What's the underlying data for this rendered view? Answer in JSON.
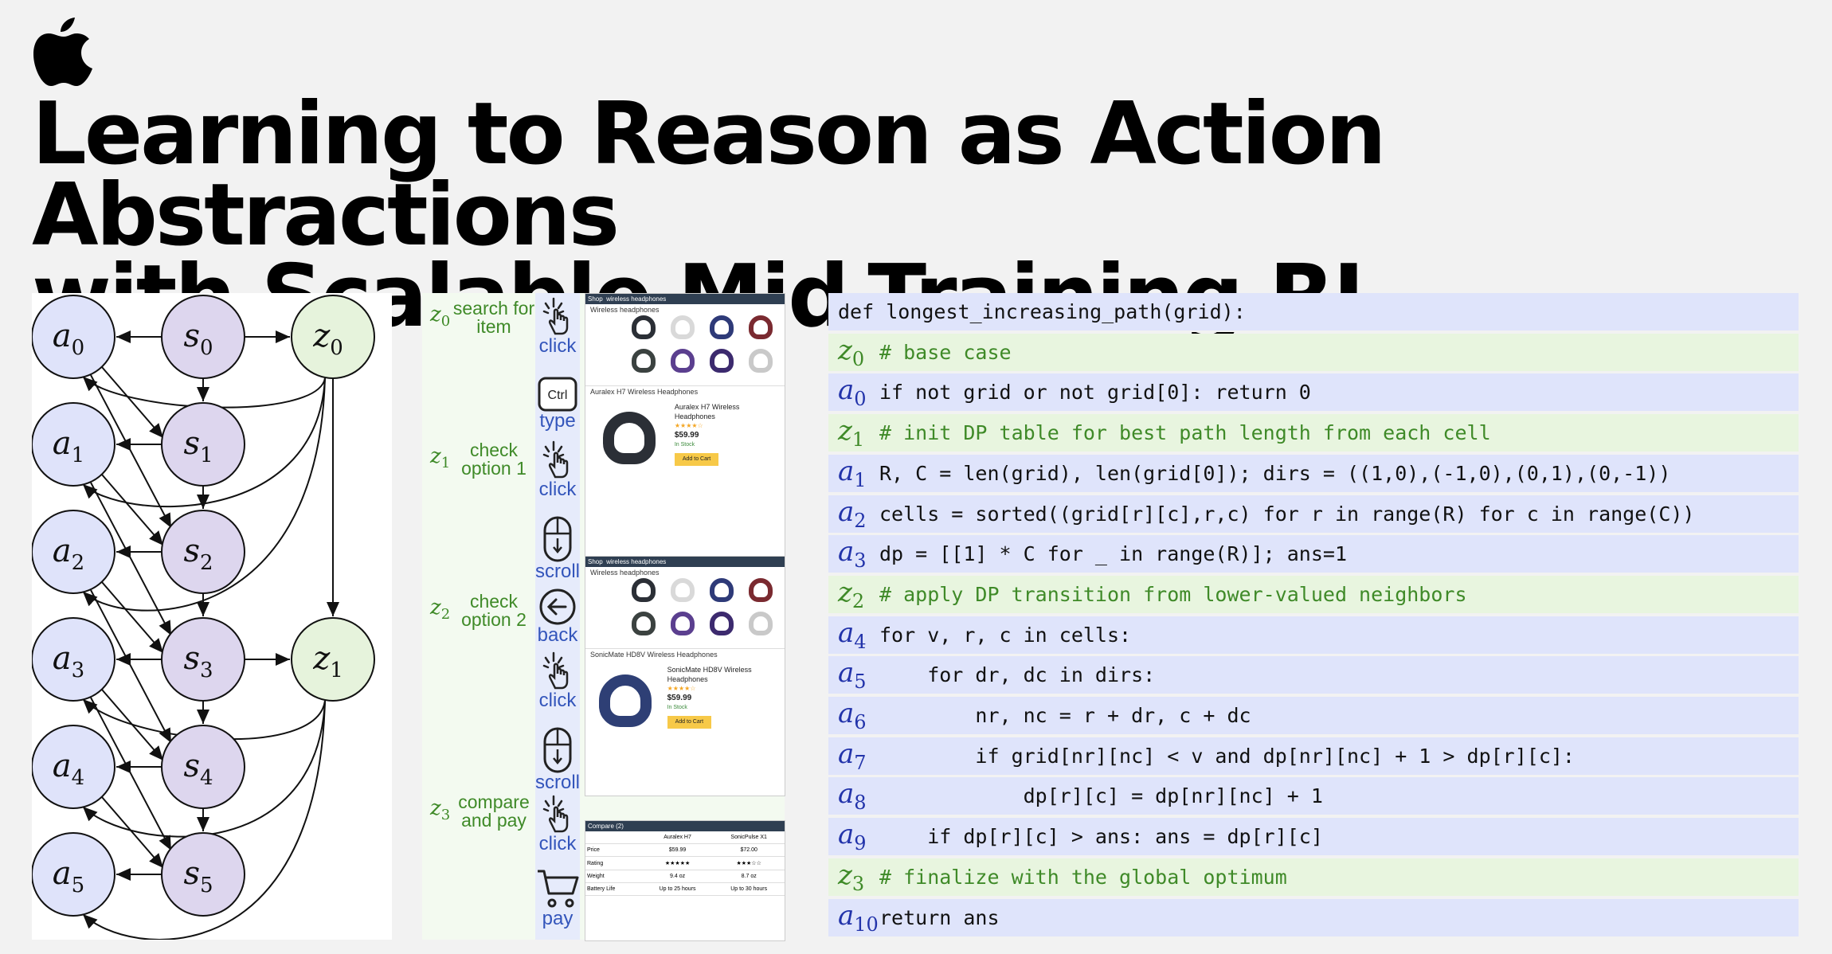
{
  "title": {
    "line1": "Learning to Reason as Action Abstractions",
    "line2": "with Scalable Mid-Training RL"
  },
  "graph": {
    "a_nodes": [
      {
        "sym": "a",
        "sub": "0"
      },
      {
        "sym": "a",
        "sub": "1"
      },
      {
        "sym": "a",
        "sub": "2"
      },
      {
        "sym": "a",
        "sub": "3"
      },
      {
        "sym": "a",
        "sub": "4"
      },
      {
        "sym": "a",
        "sub": "5"
      }
    ],
    "s_nodes": [
      {
        "sym": "s",
        "sub": "0"
      },
      {
        "sym": "s",
        "sub": "1"
      },
      {
        "sym": "s",
        "sub": "2"
      },
      {
        "sym": "s",
        "sub": "3"
      },
      {
        "sym": "s",
        "sub": "4"
      },
      {
        "sym": "s",
        "sub": "5"
      }
    ],
    "z_nodes": [
      {
        "sym": "z",
        "sub": "0"
      },
      {
        "sym": "z",
        "sub": "1"
      }
    ],
    "colors": {
      "a_fill": "#dfe3fa",
      "s_fill": "#ddd6ee",
      "z_fill": "#e6f3dc",
      "stroke": "#111111"
    }
  },
  "web": {
    "z_labels": [
      {
        "sym": "z",
        "sub": "0",
        "text": "search for item"
      },
      {
        "sym": "z",
        "sub": "1",
        "text": "check option 1"
      },
      {
        "sym": "z",
        "sub": "2",
        "text": "check option 2"
      },
      {
        "sym": "z",
        "sub": "3",
        "text": "compare and pay"
      }
    ],
    "actions": [
      {
        "icon": "click-hand-icon",
        "label": "click"
      },
      {
        "icon": "ctrl-key-icon",
        "label": "type",
        "key": "Ctrl"
      },
      {
        "icon": "click-hand-icon",
        "label": "click"
      },
      {
        "icon": "mouse-scroll-icon",
        "label": "scroll"
      },
      {
        "icon": "back-arrow-icon",
        "label": "back"
      },
      {
        "icon": "click-hand-icon",
        "label": "click"
      },
      {
        "icon": "mouse-scroll-icon",
        "label": "scroll"
      },
      {
        "icon": "click-hand-icon",
        "label": "click"
      },
      {
        "icon": "shopping-cart-icon",
        "label": "pay"
      }
    ],
    "screens": {
      "search_results": {
        "heading": "Wireless headphones",
        "colors": [
          "#2b2f36",
          "#d9d9d9",
          "#2e3a78",
          "#7a2a30",
          "#3b4240",
          "#5b3f8f",
          "#3c2a6e",
          "#c9c9c9"
        ]
      },
      "product1": {
        "name": "Auralex H7 Wireless Headphones",
        "price": "$59.99",
        "stock": "In Stock",
        "cart": "Add to Cart",
        "color": "#2b2f36"
      },
      "product2": {
        "name": "SonicMate HD8V Wireless Headphones",
        "price": "$59.99",
        "stock": "In Stock",
        "cart": "Add to Cart",
        "color": "#2e3f75"
      },
      "compare": {
        "header": "Compare (2)",
        "cols": [
          "Auralex H7",
          "SonicPulse X1"
        ],
        "rows": [
          [
            "Price",
            "$59.99",
            "$72.00"
          ],
          [
            "Rating",
            "★★★★★",
            "★★★☆☆"
          ],
          [
            "Weight",
            "9.4 oz",
            "8.7 oz"
          ],
          [
            "Battery Life",
            "Up to 25 hours",
            "Up to 30 hours"
          ]
        ]
      }
    }
  },
  "code": {
    "header": "def longest_increasing_path(grid):",
    "lines": [
      {
        "kind": "z",
        "sym": "z",
        "sub": "0",
        "text": "# base case"
      },
      {
        "kind": "a",
        "sym": "a",
        "sub": "0",
        "text": "if not grid or not grid[0]: return 0"
      },
      {
        "kind": "z",
        "sym": "z",
        "sub": "1",
        "text": "# init DP table for best path length from each cell"
      },
      {
        "kind": "a",
        "sym": "a",
        "sub": "1",
        "text": "R, C = len(grid), len(grid[0]); dirs = ((1,0),(-1,0),(0,1),(0,-1))"
      },
      {
        "kind": "a",
        "sym": "a",
        "sub": "2",
        "text": "cells = sorted((grid[r][c],r,c) for r in range(R) for c in range(C))"
      },
      {
        "kind": "a",
        "sym": "a",
        "sub": "3",
        "text": "dp = [[1] * C for _ in range(R)]; ans=1"
      },
      {
        "kind": "z",
        "sym": "z",
        "sub": "2",
        "text": "# apply DP transition from lower-valued neighbors"
      },
      {
        "kind": "a",
        "sym": "a",
        "sub": "4",
        "text": "for v, r, c in cells:"
      },
      {
        "kind": "a",
        "sym": "a",
        "sub": "5",
        "text": "    for dr, dc in dirs:"
      },
      {
        "kind": "a",
        "sym": "a",
        "sub": "6",
        "text": "        nr, nc = r + dr, c + dc"
      },
      {
        "kind": "a",
        "sym": "a",
        "sub": "7",
        "text": "        if grid[nr][nc] < v and dp[nr][nc] + 1 > dp[r][c]:"
      },
      {
        "kind": "a",
        "sym": "a",
        "sub": "8",
        "text": "            dp[r][c] = dp[nr][nc] + 1"
      },
      {
        "kind": "a",
        "sym": "a",
        "sub": "9",
        "text": "    if dp[r][c] > ans: ans = dp[r][c]"
      },
      {
        "kind": "z",
        "sym": "z",
        "sub": "3",
        "text": "# finalize with the global optimum"
      },
      {
        "kind": "a",
        "sym": "a",
        "sub": "10",
        "text": "return ans"
      }
    ]
  }
}
